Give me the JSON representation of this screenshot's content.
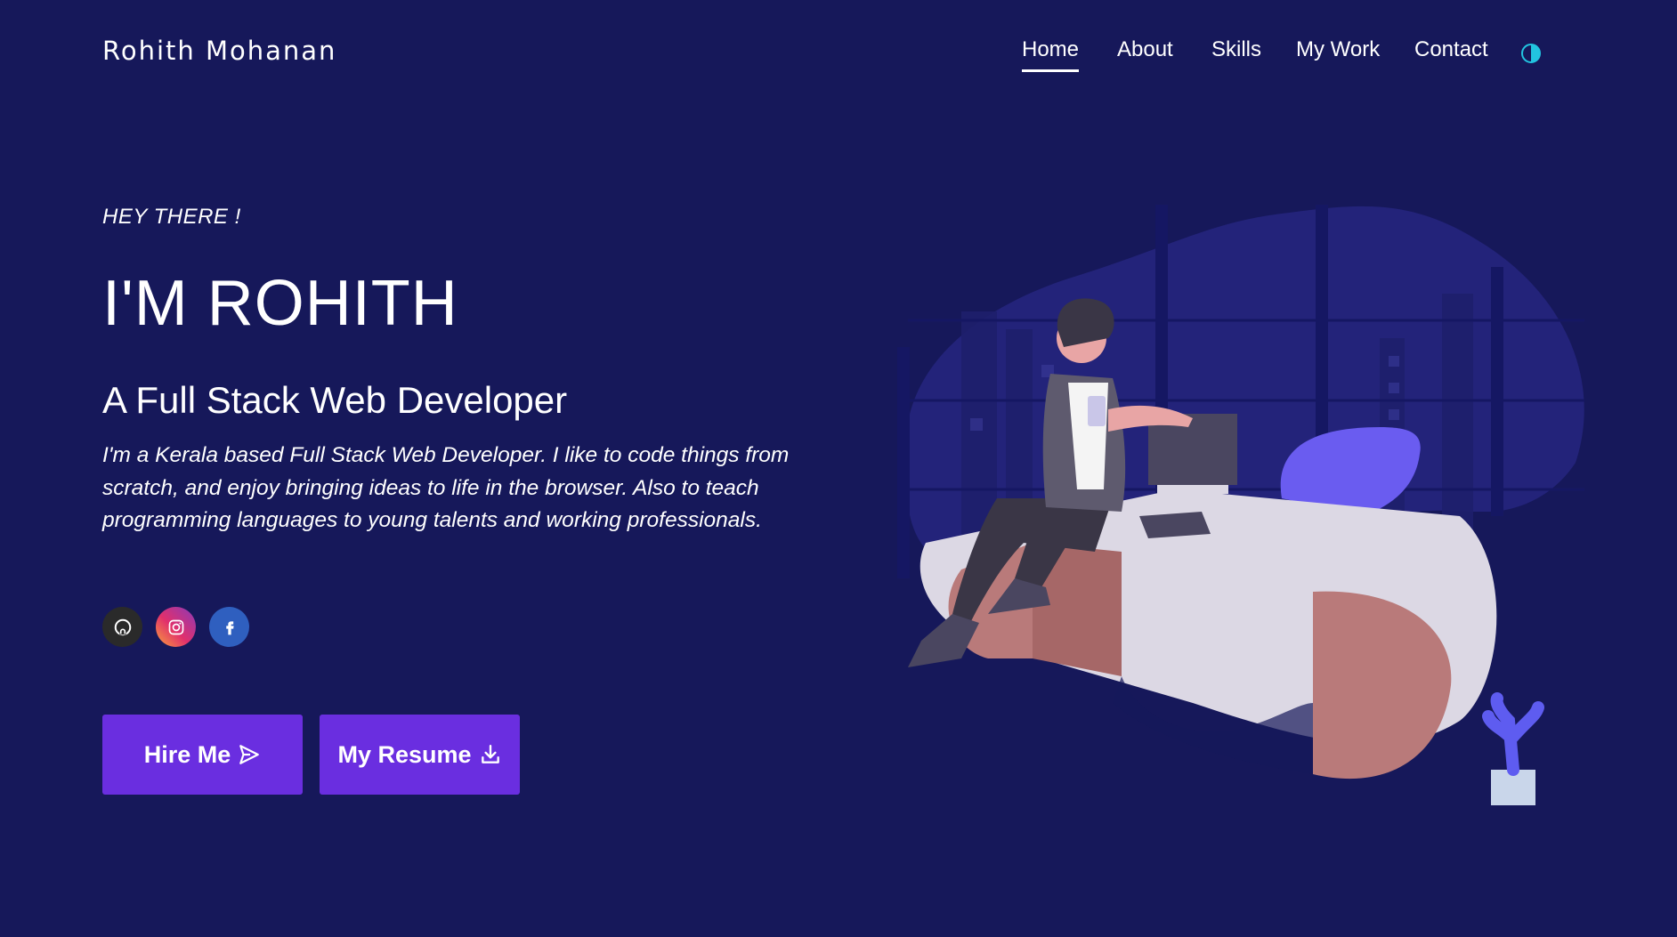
{
  "header": {
    "brand": "Rohith Mohanan",
    "nav": [
      {
        "label": "Home",
        "active": true
      },
      {
        "label": "About",
        "active": false
      },
      {
        "label": "Skills",
        "active": false
      },
      {
        "label": "My Work",
        "active": false
      },
      {
        "label": "Contact",
        "active": false
      }
    ],
    "theme_toggle_icon": "half-circle-theme-icon"
  },
  "hero": {
    "greeting": "HEY THERE !",
    "name": "I'M ROHITH",
    "role": "A Full Stack Web Developer",
    "description": "I'm a Kerala based Full Stack Web Developer. I like to code things from scratch, and enjoy bringing ideas to life in the browser. Also to teach programming languages to young talents and working professionals."
  },
  "socials": [
    {
      "name": "github",
      "icon": "github-icon"
    },
    {
      "name": "instagram",
      "icon": "instagram-icon"
    },
    {
      "name": "facebook",
      "icon": "facebook-icon"
    }
  ],
  "buttons": {
    "hire": {
      "label": "Hire Me",
      "icon": "send-icon"
    },
    "resume": {
      "label": "My Resume",
      "icon": "download-icon"
    }
  },
  "colors": {
    "background": "#16185a",
    "accent": "#6a2ee0",
    "toggle": "#22c4e0"
  }
}
